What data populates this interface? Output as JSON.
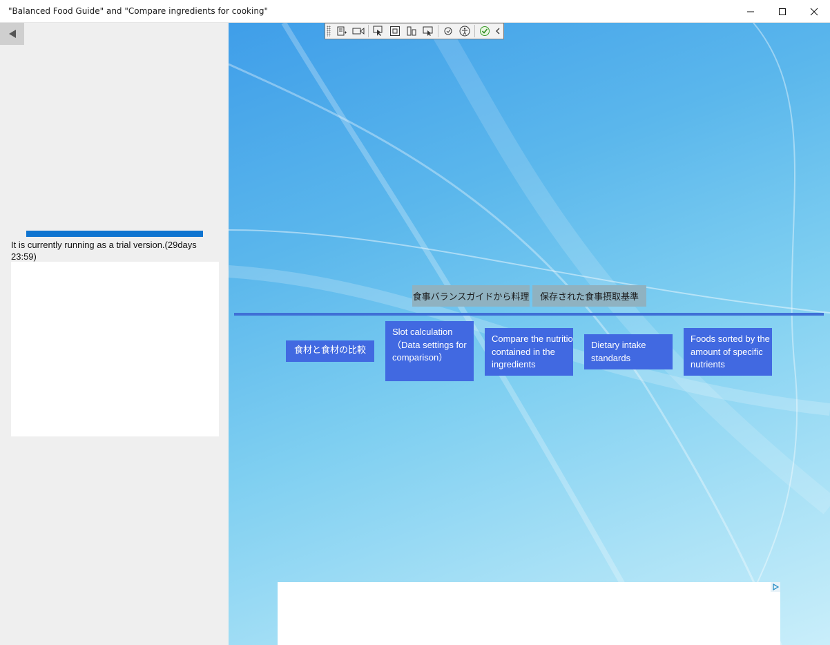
{
  "window": {
    "title": "\"Balanced Food Guide\" and \"Compare ingredients for cooking\"",
    "controls": [
      "minimize-icon",
      "maximize-icon",
      "close-icon"
    ]
  },
  "sidebar": {
    "back_icon": "triangle-left-icon",
    "progress": 1.0,
    "trial_text": "It is currently running as a trial version.(29days 23:59)"
  },
  "toolbar": {
    "icons": [
      "live-visual-tree-icon",
      "record-icon",
      "select-element-icon",
      "display-layout-adorners-icon",
      "track-focus-icon",
      "preview-selection-icon",
      "hot-reload-icon",
      "accessibility-icon",
      "binding-check-icon",
      "collapse-icon"
    ]
  },
  "main": {
    "top_buttons": [
      "食事バランスガイドから料理",
      "保存された食事摂取基準"
    ],
    "menu_buttons": [
      "食材と食材の比較",
      "Slot calculation（Data settings for comparison）",
      "Compare the nutrition contained in the ingredients",
      "Dietary intake standards",
      "Foods sorted by the amount of specific nutrients"
    ],
    "ad_icon": "ad-choices-icon"
  },
  "colors": {
    "accent": "#4169e1",
    "progress": "#0f74d0",
    "top_button": "#8fb2c1"
  }
}
